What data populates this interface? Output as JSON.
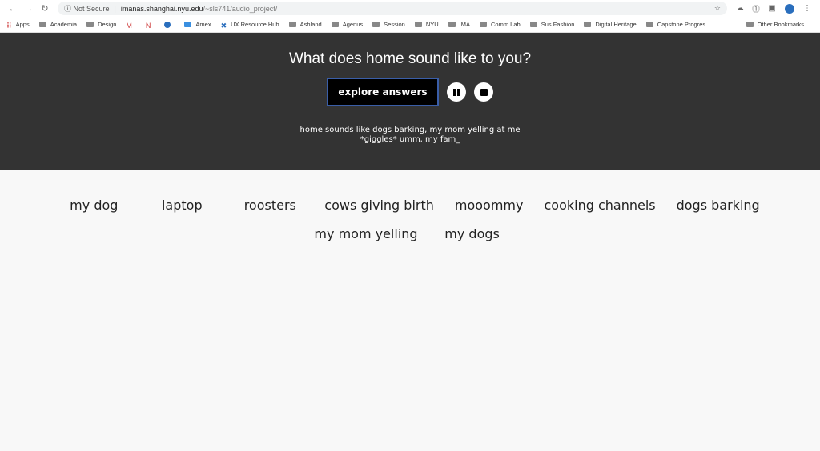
{
  "browser": {
    "security": "Not Secure",
    "host": "imanas.shanghai.nyu.edu",
    "path": "/~sls741/audio_project/"
  },
  "bookmarks": [
    {
      "label": "Apps",
      "icon": "apps-grid-icon"
    },
    {
      "label": "Academia",
      "icon": "folder-icon"
    },
    {
      "label": "Design",
      "icon": "folder-icon"
    },
    {
      "label": "",
      "icon": "gmail-icon"
    },
    {
      "label": "",
      "icon": "netflix-icon"
    },
    {
      "label": "",
      "icon": "site-icon"
    },
    {
      "label": "Amex",
      "icon": "amex-icon"
    },
    {
      "label": "UX Resource Hub",
      "icon": "ux-icon"
    },
    {
      "label": "Ashland",
      "icon": "ashland-icon"
    },
    {
      "label": "Agenus",
      "icon": "folder-icon"
    },
    {
      "label": "Session",
      "icon": "folder-icon"
    },
    {
      "label": "NYU",
      "icon": "folder-icon"
    },
    {
      "label": "IMA",
      "icon": "folder-icon"
    },
    {
      "label": "Comm Lab",
      "icon": "folder-icon"
    },
    {
      "label": "Sus Fashion",
      "icon": "folder-icon"
    },
    {
      "label": "Digital Heritage",
      "icon": "folder-icon"
    },
    {
      "label": "Capstone Progres...",
      "icon": "plus-icon"
    }
  ],
  "other_bookmarks": "Other Bookmarks",
  "hero": {
    "title": "What does home sound like to you?",
    "explore_label": "explore answers",
    "transcript": "home sounds like dogs barking, my mom yelling at me *giggles* umm, my fam_"
  },
  "words": [
    "my dog",
    "laptop",
    "roosters",
    "cows giving birth",
    "mooommy",
    "cooking channels",
    "dogs barking",
    "my mom yelling",
    "my dogs"
  ]
}
